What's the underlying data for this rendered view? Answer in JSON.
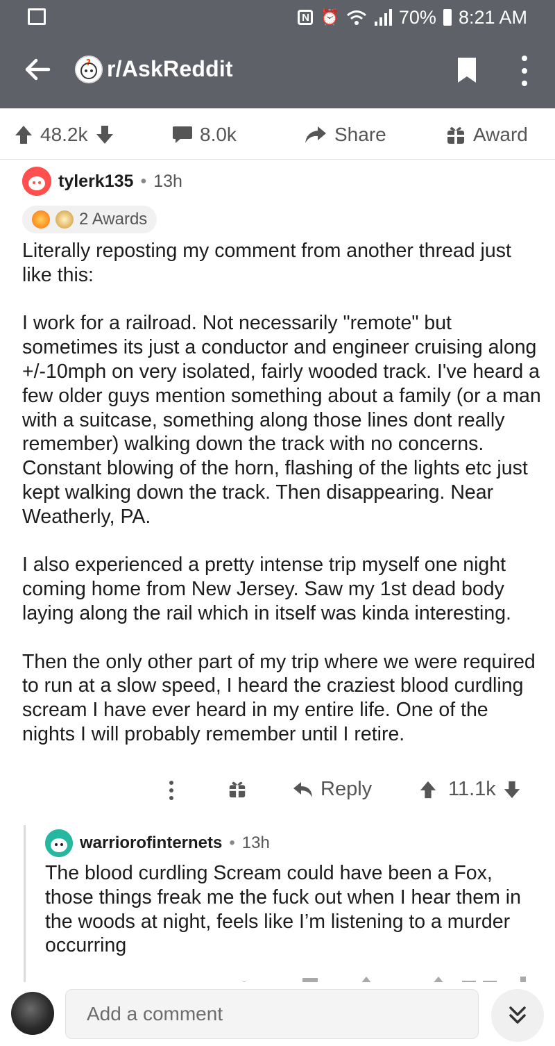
{
  "status_bar": {
    "battery": "70%",
    "time": "8:21 AM"
  },
  "app_bar": {
    "title": "r/AskReddit"
  },
  "post_actions": {
    "upvotes": "48.2k",
    "comments": "8.0k",
    "share_label": "Share",
    "award_label": "Award"
  },
  "comment": {
    "author": "tylerk135",
    "separator": "•",
    "time": "13h",
    "awards_label": "2 Awards",
    "paragraphs": [
      "Literally reposting my comment from another thread just like this:",
      "I work for a railroad. Not necessarily \"remote\" but sometimes its just a conductor and engineer cruising along +/-10mph on very isolated, fairly wooded track. I've heard a few older guys mention something about a family (or a man with a suitcase, something along those lines dont really remember) walking down the track with no concerns. Constant blowing of the horn, flashing of the lights etc just kept walking down the track. Then disappearing. Near Weatherly, PA.",
      "I also experienced a pretty intense trip myself one night coming home from New Jersey. Saw my 1st dead body laying along the rail which in itself was kinda interesting.",
      "Then the only other part of my trip where we were required to run at a slow speed, I heard the craziest blood curdling scream I have ever heard in my entire life. One of the nights I will probably remember until I retire."
    ],
    "reply_label": "Reply",
    "score": "11.1k"
  },
  "reply": {
    "author": "warriorofinternets",
    "separator": "•",
    "time": "13h",
    "body": "The blood curdling Scream could have been a Fox, those things freak me the fuck out when I hear them in the woods at night, feels like I’m listening to a murder occurring"
  },
  "bottom_bar": {
    "placeholder": "Add a comment"
  },
  "colors": {
    "app_bar": "#5e6268",
    "text": "#1c1c1c",
    "muted": "#555555"
  }
}
